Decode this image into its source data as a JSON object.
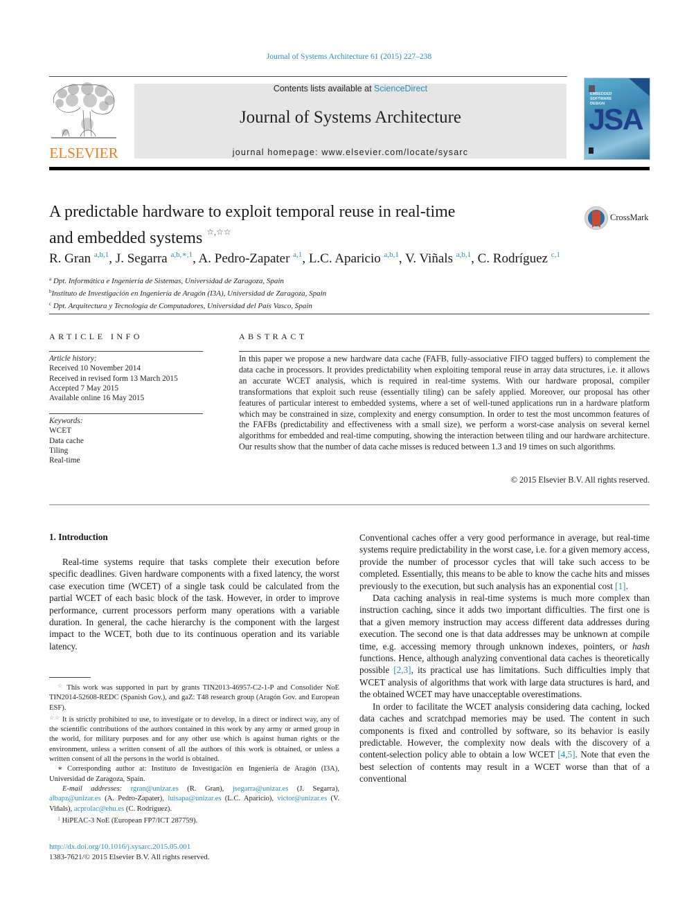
{
  "header": {
    "citation": "Journal of Systems Architecture 61 (2015) 227–238",
    "contents_prefix": "Contents lists available at ",
    "contents_link": "ScienceDirect",
    "journal_title": "Journal of Systems Architecture",
    "homepage_prefix": "journal homepage: ",
    "homepage_url": "www.elsevier.com/locate/sysarc",
    "publisher_logo": "ELSEVIER",
    "cover": {
      "subtitle_lines": [
        "EMBEDDED",
        "SOFTWARE",
        "DESIGN"
      ],
      "acronym": "JSA"
    }
  },
  "article": {
    "title_line1": "A predictable hardware to exploit temporal reuse in real-time",
    "title_line2": "and embedded systems",
    "title_marks": "☆,☆☆",
    "crossmark_label": "CrossMark",
    "authors": [
      {
        "name": "R. Gran",
        "sup": "a,b,1",
        "sep": ", "
      },
      {
        "name": "J. Segarra",
        "sup": "a,b,∗,1",
        "sep": ", "
      },
      {
        "name": "A. Pedro-Zapater",
        "sup": "a,1",
        "sep": ", "
      },
      {
        "name": "L.C. Aparicio",
        "sup": "a,b,1",
        "sep": ", "
      },
      {
        "name": "V. Viñals",
        "sup": "a,b,1",
        "sep": ", "
      },
      {
        "name": "C. Rodríguez",
        "sup": "c,1",
        "sep": ""
      }
    ],
    "affiliations": [
      {
        "key": "a",
        "text": "Dpt. Informática e Ingeniería de Sistemas, Universidad de Zaragoza, Spain"
      },
      {
        "key": "b",
        "text": "Instituto de Investigación en Ingeniería de Aragón (I3A), Universidad de Zaragoza, Spain"
      },
      {
        "key": "c",
        "text": "Dpt. Arquitectura y Tecnología de Computadores, Universidad del País Vasco, Spain"
      }
    ]
  },
  "article_info": {
    "heading": "ARTICLE INFO",
    "history_label": "Article history:",
    "history": [
      "Received 10 November 2014",
      "Received in revised form 13 March 2015",
      "Accepted 7 May 2015",
      "Available online 16 May 2015"
    ],
    "keywords_label": "Keywords:",
    "keywords": [
      "WCET",
      "Data cache",
      "Tiling",
      "Real-time"
    ]
  },
  "abstract": {
    "heading": "ABSTRACT",
    "text": "In this paper we propose a new hardware data cache (FAFB, fully-associative FIFO tagged buffers) to complement the data cache in processors. It provides predictability when exploiting temporal reuse in array data structures, i.e. it allows an accurate WCET analysis, which is required in real-time systems. With our hardware proposal, compiler transformations that exploit such reuse (essentially tiling) can be safely applied. Moreover, our proposal has other features of particular interest to embedded systems, where a set of well-tuned applications run in a hardware platform which may be constrained in size, complexity and energy consumption. In order to test the most uncommon features of the FAFBs (predictability and effectiveness with a small size), we perform a worst-case analysis on several kernel algorithms for embedded and real-time computing, showing the interaction between tiling and our hardware architecture. Our results show that the number of data cache misses is reduced between 1.3 and 19 times on such algorithms.",
    "copyright": "© 2015 Elsevier B.V. All rights reserved."
  },
  "body": {
    "section_heading": "1. Introduction",
    "left_paragraph": "Real-time systems require that tasks complete their execution before specific deadlines. Given hardware components with a fixed latency, the worst case execution time (WCET) of a single task could be calculated from the partial WCET of each basic block of the task. However, in order to improve performance, current processors perform many operations with a variable duration. In general, the cache hierarchy is the component with the largest impact to the WCET, both due to its continuous operation and its variable latency.",
    "right_p1": {
      "text": "Conventional caches offer a very good performance in average, but real-time systems require predictability in the worst case, i.e. for a given memory access, provide the number of processor cycles that will take such access to be completed. Essentially, this means to be able to know the cache hits and misses previously to the execution, but such analysis has an exponential cost ",
      "ref": "[1]",
      "tail": "."
    },
    "right_p2": {
      "text_a": "Data caching analysis in real-time systems is much more complex than instruction caching, since it adds two important difficulties. The first one is that a given memory instruction may access different data addresses during execution. The second one is that data addresses may be unknown at compile time, e.g. accessing memory through unknown indexes, pointers, or ",
      "em": "hash",
      "text_b": " functions. Hence, although analyzing conventional data caches is theoretically possible ",
      "ref": "[2,3]",
      "text_c": ", its practical use has limitations. Such difficulties imply that WCET analysis of algorithms that work with large data structures is hard, and the obtained WCET may have unacceptable overestimations."
    },
    "right_p3": {
      "text_a": "In order to facilitate the WCET analysis considering data caching, locked data caches and scratchpad memories may be used. The content in such components is fixed and controlled by software, so its behavior is easily predictable. However, the complexity now deals with the discovery of a content-selection policy able to obtain a low WCET ",
      "ref": "[4,5]",
      "text_b": ". Note that even the best selection of contents may result in a WCET worse than that of a conventional"
    }
  },
  "footnotes": {
    "fn1_mark": "☆",
    "fn1": "This work was supported in part by grants TIN2013-46957-C2-1-P and Consolider NoE TIN2014-52608-REDC (Spanish Gov.), and gaZ: T48 research group (Aragón Gov. and European ESF).",
    "fn2_mark": "☆☆",
    "fn2": "It is strictly prohibited to use, to investigate or to develop, in a direct or indirect way, any of the scientific contributions of the authors contained in this work by any army or armed group in the world, for military purposes and for any other use which is against human rights or the environment, unless a written consent of all the authors of this work is obtained, or unless a written consent of all the persons in the world is obtained.",
    "corr_mark": "∗",
    "corr": "Corresponding author at: Instituto de Investigación en Ingeniería de Aragón (I3A), Universidad de Zaragoza, Spain.",
    "email_label": "E-mail addresses:",
    "emails": [
      {
        "addr": "rgran@unizar.es",
        "who": " (R. Gran), "
      },
      {
        "addr": "jsegarra@unizar.es",
        "who": " (J. Segarra), "
      },
      {
        "addr": "albapz@unizar.es",
        "who": " (A. Pedro-Zapater), "
      },
      {
        "addr": "luisapa@unizar.es",
        "who": " (L.C. Aparicio), "
      },
      {
        "addr": "victor@unizar.es",
        "who": " (V. Viñals), "
      },
      {
        "addr": "acprolac@ehu.es",
        "who": " (C. Rodríguez)."
      }
    ],
    "fn3_mark": "1",
    "fn3": "HiPEAC-3 NoE (European FP7/ICT 287759)."
  },
  "footer": {
    "doi": "http://dx.doi.org/10.1016/j.sysarc.2015.05.001",
    "issn_copyright": "1383-7621/© 2015 Elsevier B.V. All rights reserved."
  },
  "colors": {
    "link": "#2a8bbd",
    "elsevier_orange": "#f07c1f",
    "header_box": "#e6e6e6"
  }
}
